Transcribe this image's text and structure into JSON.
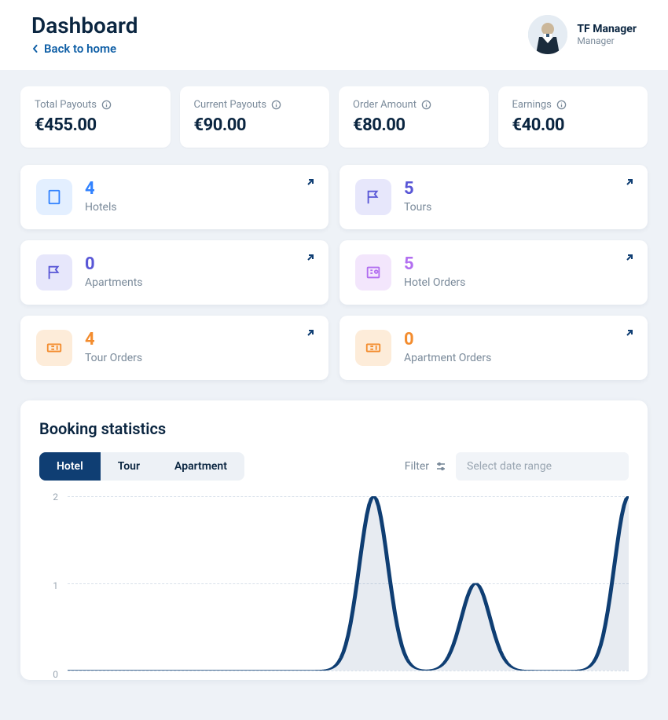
{
  "header": {
    "title": "Dashboard",
    "back_label": "Back to home",
    "user": {
      "name": "TF Manager",
      "role": "Manager"
    }
  },
  "stats": [
    {
      "label": "Total Payouts",
      "value": "€455.00"
    },
    {
      "label": "Current Payouts",
      "value": "€90.00"
    },
    {
      "label": "Order Amount",
      "value": "€80.00"
    },
    {
      "label": "Earnings",
      "value": "€40.00"
    }
  ],
  "counters": [
    {
      "value": "4",
      "label": "Hotels",
      "color": "blue",
      "icon": "building-icon"
    },
    {
      "value": "5",
      "label": "Tours",
      "color": "indigo",
      "icon": "flag-icon"
    },
    {
      "value": "0",
      "label": "Apartments",
      "color": "indigo",
      "icon": "flag-icon"
    },
    {
      "value": "5",
      "label": "Hotel Orders",
      "color": "purple",
      "icon": "receipt-icon"
    },
    {
      "value": "4",
      "label": "Tour Orders",
      "color": "orange",
      "icon": "ticket-icon"
    },
    {
      "value": "0",
      "label": "Apartment Orders",
      "color": "orange",
      "icon": "ticket-icon"
    }
  ],
  "chart": {
    "title": "Booking statistics",
    "tabs": [
      "Hotel",
      "Tour",
      "Apartment"
    ],
    "active_tab": 0,
    "filter_label": "Filter",
    "date_placeholder": "Select date range",
    "y_ticks": [
      "2",
      "1",
      "0"
    ]
  },
  "chart_data": {
    "type": "line",
    "title": "Booking statistics",
    "xlabel": "",
    "ylabel": "",
    "ylim": [
      0,
      2
    ],
    "series": [
      {
        "name": "Hotel",
        "values": [
          0,
          0,
          0,
          0,
          0,
          0,
          2,
          0,
          1,
          0,
          0,
          2
        ]
      }
    ],
    "x": [
      1,
      2,
      3,
      4,
      5,
      6,
      7,
      8,
      9,
      10,
      11,
      12
    ]
  }
}
